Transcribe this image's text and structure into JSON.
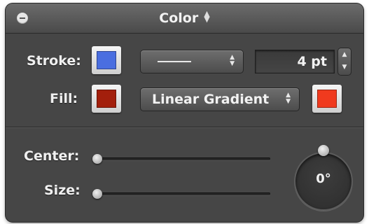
{
  "panel": {
    "title": "Color",
    "title_arrows": [
      "▲",
      "▼"
    ]
  },
  "stroke": {
    "label": "Stroke:",
    "color": "#4a6ee0",
    "size": "4 pt",
    "stepper_arrows": [
      "▲",
      "▼"
    ],
    "popup_arrows": [
      "▲",
      "▼"
    ]
  },
  "fill": {
    "label": "Fill:",
    "color": "#a31f0c",
    "type": "Linear Gradient",
    "type_arrows": [
      "▲",
      "▼"
    ],
    "end_color": "#f03a1e"
  },
  "gradient": {
    "center_label": "Center:",
    "size_label": "Size:",
    "center_value": 0,
    "size_value": 0,
    "angle": "0°"
  }
}
